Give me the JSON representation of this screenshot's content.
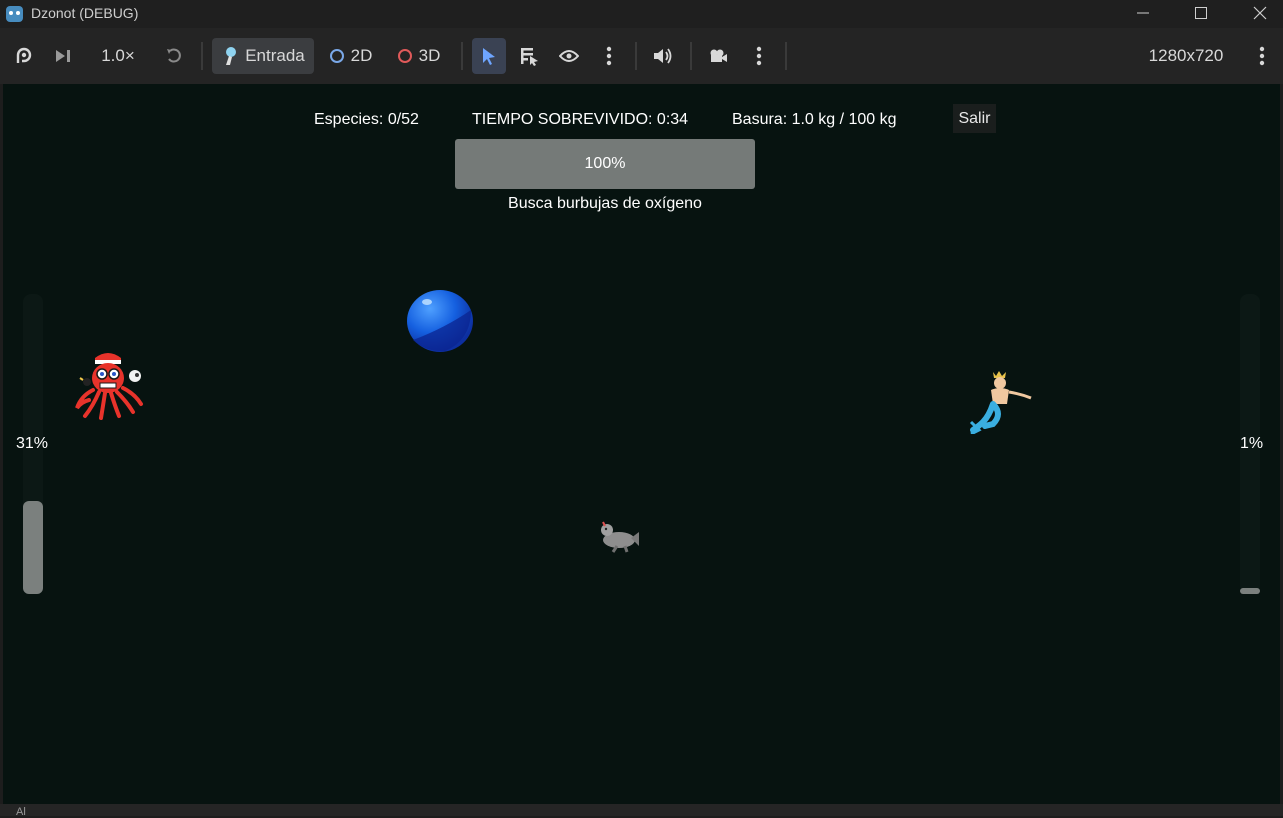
{
  "window": {
    "title": "Dzonot (DEBUG)",
    "controls": [
      "minimize-icon",
      "maximize-icon",
      "close-icon"
    ]
  },
  "toolbar": {
    "speed": "1.0×",
    "input_label": "Entrada",
    "mode_2d": "2D",
    "mode_3d": "3D",
    "resolution": "1280x720",
    "icons": [
      "remote-debug-icon",
      "step-icon",
      "reset-speed-icon",
      "select-arrow-icon",
      "list-select-icon",
      "eye-icon",
      "more-icon",
      "speaker-icon",
      "camera-icon",
      "more-icon",
      "more-icon"
    ],
    "colors": {
      "ring_2d": "#7aa8e8",
      "ring_3d": "#e05a5a"
    }
  },
  "hud": {
    "species": "Especies: 0/52",
    "time_survived": "TIEMPO SOBREVIVIDO: 0:34",
    "trash": "Basura: 1.0 kg / 100 kg",
    "exit_label": "Salir",
    "oxygen_percent": "100%",
    "oxygen_level": 1.0,
    "hint": "Busca burbujas de oxígeno"
  },
  "side_bars": {
    "left": {
      "label": "31%",
      "level": 0.31
    },
    "right": {
      "label": "1%",
      "level": 0.01
    }
  },
  "sprites": [
    "octopus-sprite",
    "oxygen-bubble",
    "seal-player-sprite",
    "mermaid-sprite"
  ],
  "colors": {
    "viewport_bg": "#071310",
    "bubble": "#1560e0",
    "octopus": "#e8332b"
  },
  "bottom_strip": {
    "text": "Al"
  }
}
